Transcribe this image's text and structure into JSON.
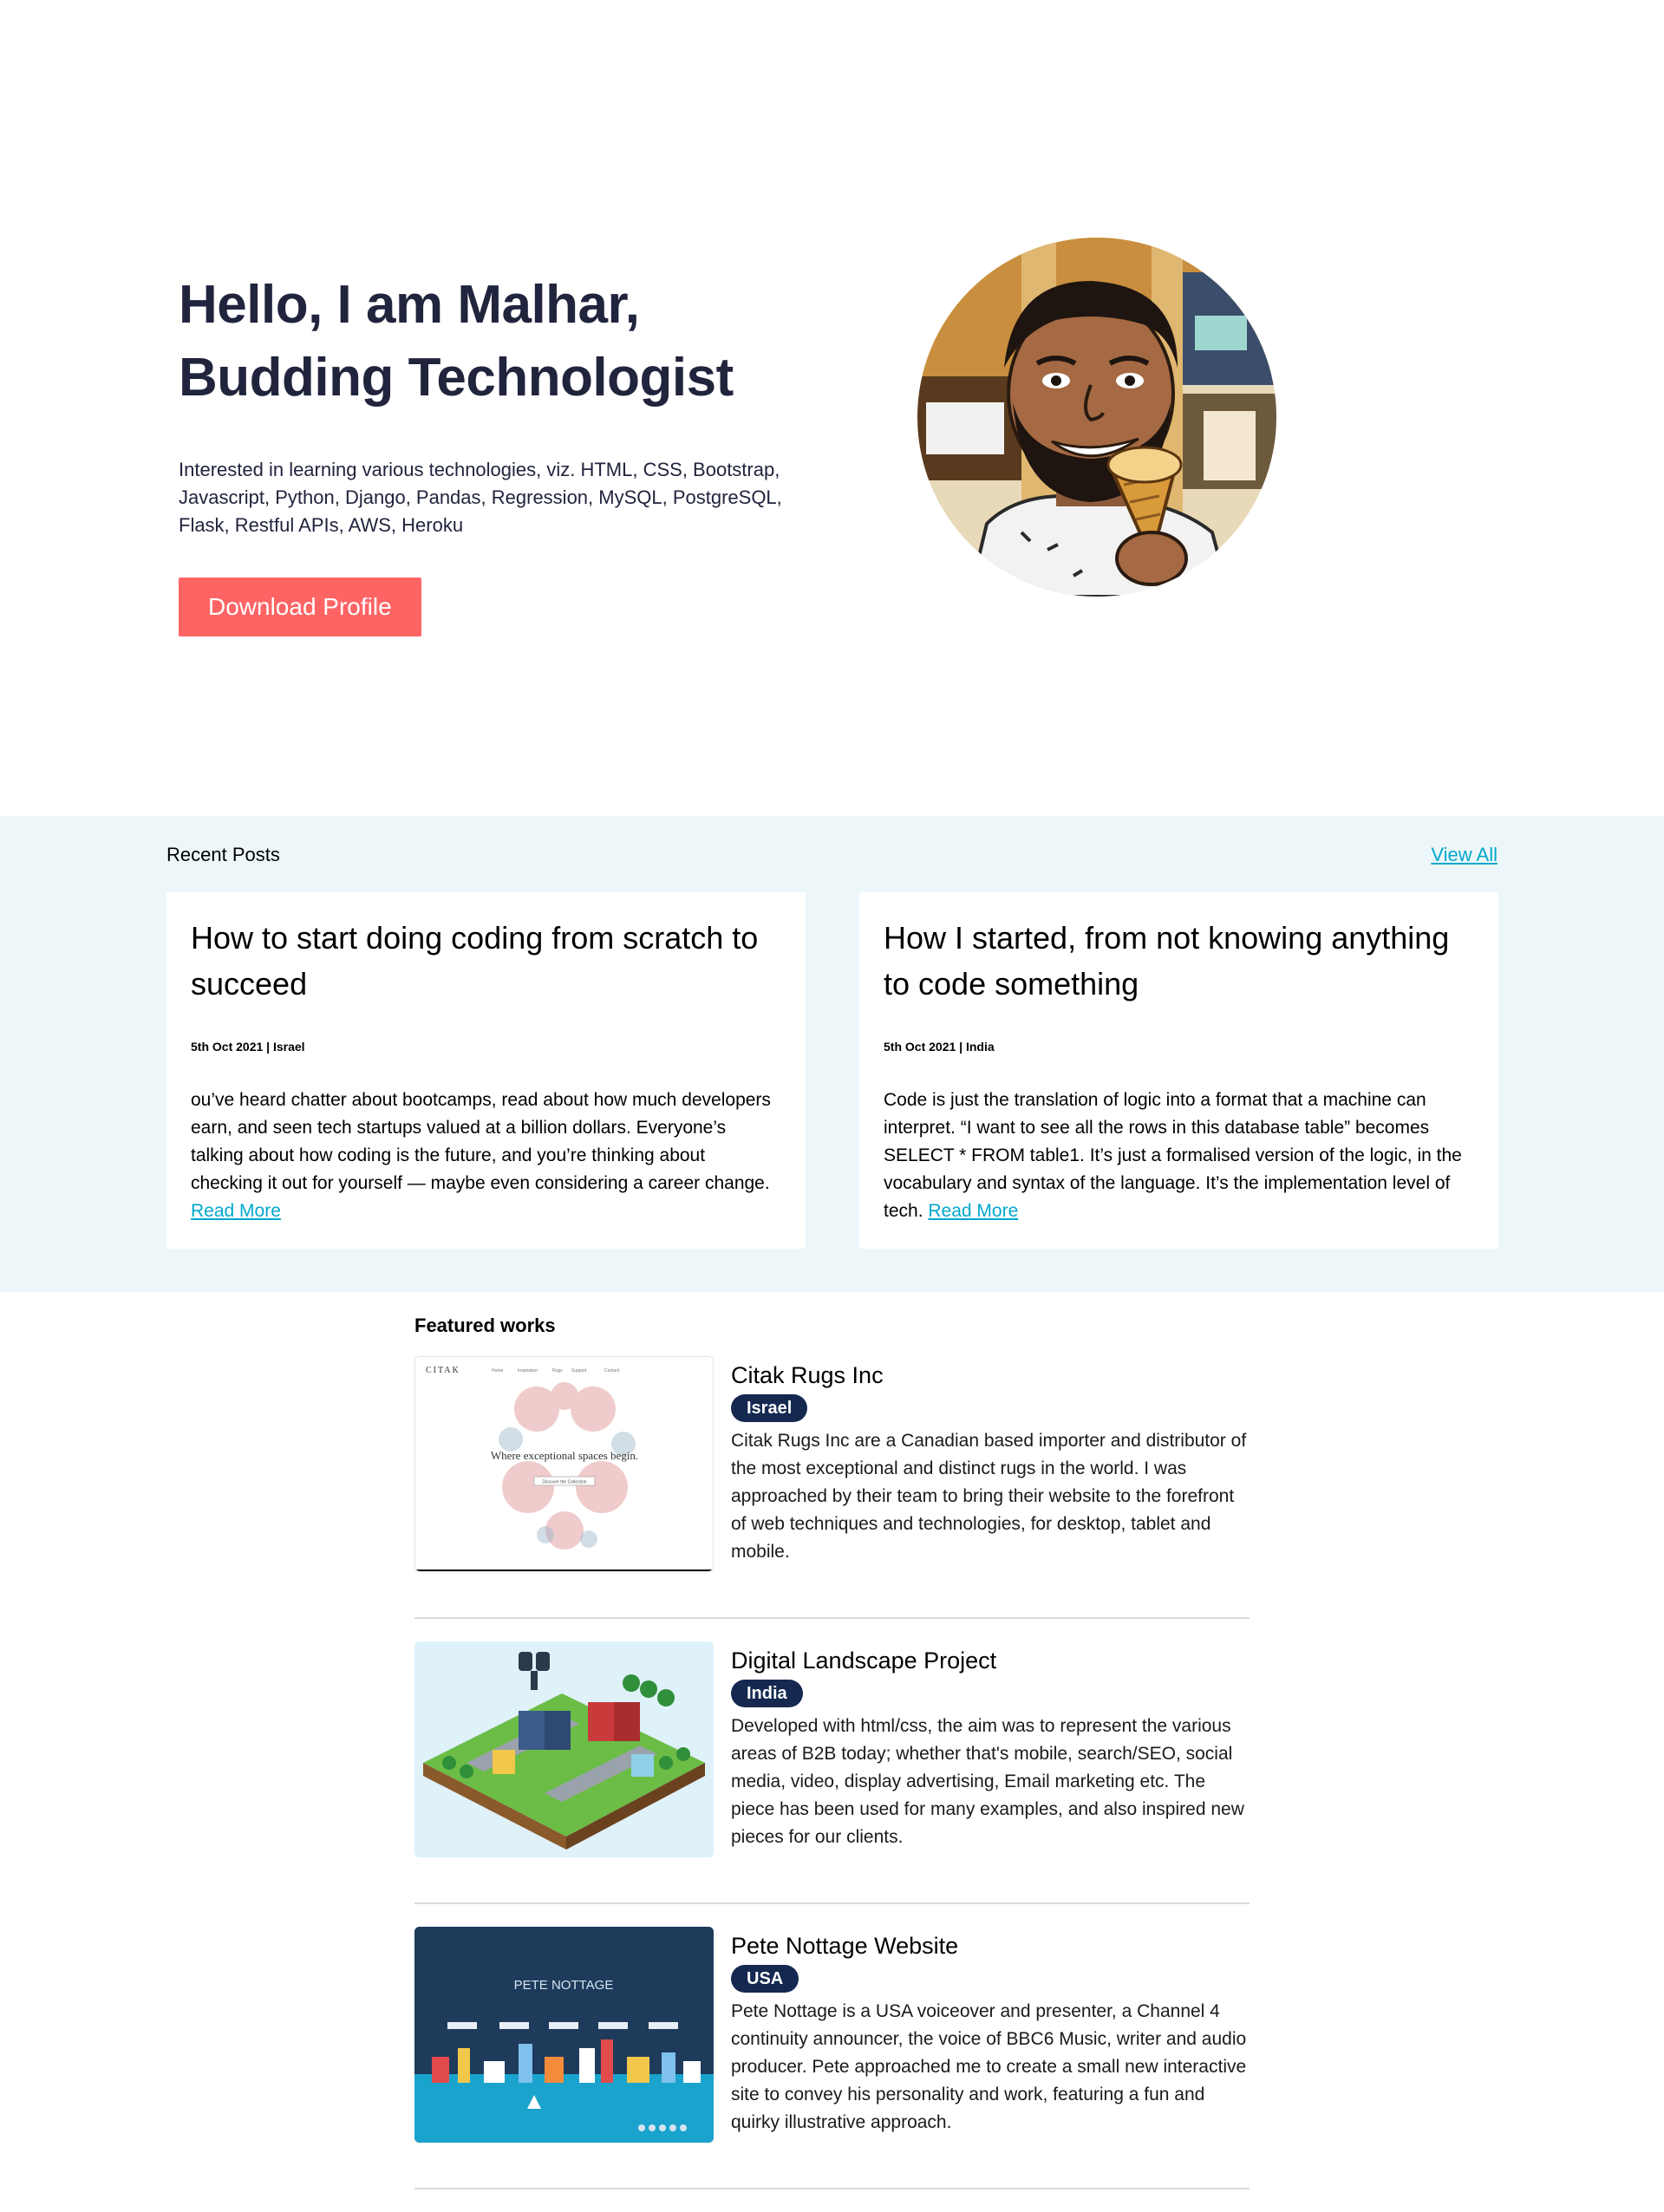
{
  "hero": {
    "title_line1": "Hello, I am Malhar,",
    "title_line2": "Budding Technologist",
    "description": "Interested in learning various technologies, viz. HTML, CSS, Bootstrap, Javascript, Python, Django, Pandas, Regression, MySQL, PostgreSQL, Flask, Restful APIs, AWS, Heroku",
    "button_label": "Download Profile",
    "button_color": "#ff6464"
  },
  "recent_posts": {
    "title": "Recent Posts",
    "view_all_label": "View All",
    "accent_color": "#00a8cc",
    "background_color": "#edf7fa",
    "posts": [
      {
        "title": "How to start doing coding from scratch to succeed",
        "meta": "5th Oct 2021 | Israel",
        "body": "ou’ve heard chatter about bootcamps, read about how much developers earn, and seen tech startups valued at a billion dollars. Everyone’s talking about how coding is the future, and you’re thinking about checking it out for yourself — maybe even considering a career change.",
        "read_more_label": "Read More"
      },
      {
        "title": "How I started, from not knowing anything to code something",
        "meta": "5th Oct 2021 | India",
        "body": "Code is just the translation of logic into a format that a machine can interpret. “I want to see all the rows in this database table” becomes SELECT * FROM table1. It’s just a formalised version of the logic, in the vocabulary and syntax of the language. It’s the implementation level of tech.",
        "read_more_label": "Read More"
      }
    ]
  },
  "featured": {
    "title": "Featured works",
    "tag_color": "#142850",
    "works": [
      {
        "name": "Citak Rugs Inc",
        "tag": "Israel",
        "description": "Citak Rugs Inc are a Canadian based importer and distributor of the most exceptional and distinct rugs in the world. I was approached by their team to bring their website to the forefront of web techniques and technologies, for desktop, tablet and mobile.",
        "thumb": {
          "logo": "CITAK",
          "nav": [
            "Home",
            "Inspiration",
            "Rugs",
            "Support",
            "Contact"
          ],
          "tagline": "Where exceptional spaces begin.",
          "cta": "Discover the Collection"
        }
      },
      {
        "name": "Digital Landscape Project",
        "tag": "India",
        "description": "Developed with html/css, the aim was to represent the various areas of B2B today; whether that's mobile, search/SEO, social media, video, display advertising, Email marketing etc. The piece has been used for many examples, and also inspired new pieces for our clients."
      },
      {
        "name": "Pete Nottage Website",
        "tag": "USA",
        "description": "Pete Nottage is a USA voiceover and presenter, a Channel 4 continuity announcer, the voice of BBC6 Music, writer and audio producer. Pete approached me to create a small new interactive site to convey his personality and work, featuring a fun and quirky illustrative approach.",
        "thumb": {
          "heading": "PETE NOTTAGE"
        }
      }
    ]
  }
}
